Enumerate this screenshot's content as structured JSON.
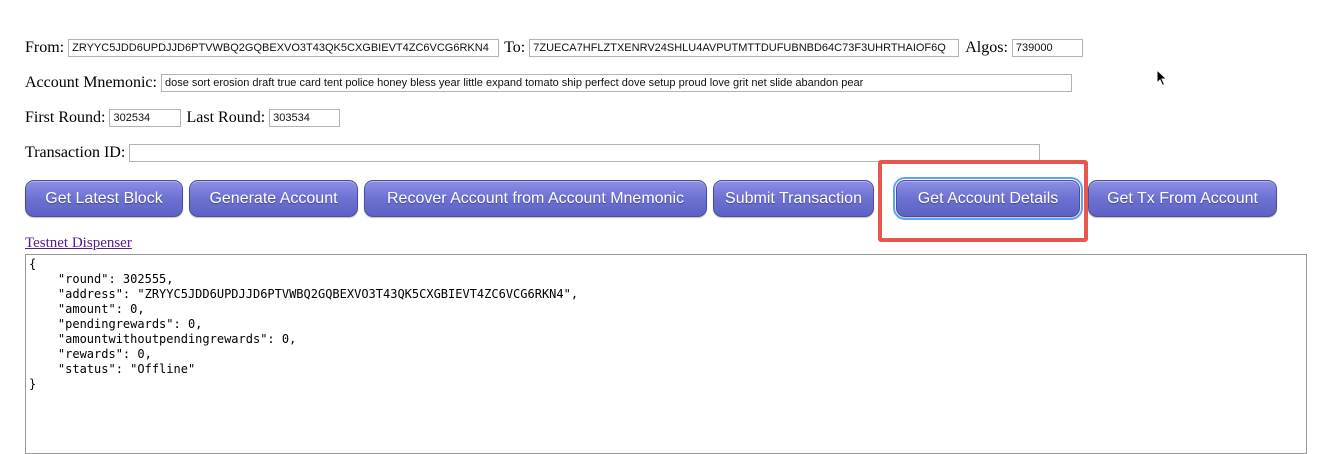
{
  "form": {
    "from_label": "From:",
    "from_value": "ZRYYC5JDD6UPDJJD6PTVWBQ2GQBEXVO3T43QK5CXGBIEVT4ZC6VCG6RKN4",
    "to_label": "To:",
    "to_value": "7ZUECA7HFLZTXENRV24SHLU4AVPUTMTTDUFUBNBD64C73F3UHRTHAIOF6Q",
    "algos_label": "Algos:",
    "algos_value": "739000",
    "mnemonic_label": "Account Mnemonic:",
    "mnemonic_value": "dose sort erosion draft true card tent police honey bless year little expand tomato ship perfect dove setup proud love grit net slide abandon pear",
    "first_round_label": "First Round:",
    "first_round_value": "302534",
    "last_round_label": "Last Round:",
    "last_round_value": "303534",
    "txid_label": "Transaction ID:",
    "txid_value": ""
  },
  "buttons": {
    "get_latest_block": "Get Latest Block",
    "generate_account": "Generate Account",
    "recover_account": "Recover Account from Account Mnemonic",
    "submit_transaction": "Submit Transaction",
    "get_account_details": "Get Account Details",
    "get_tx_from_account": "Get Tx From Account"
  },
  "link": {
    "testnet_dispenser": "Testnet Dispenser"
  },
  "output": {
    "text": "{\n    \"round\": 302555,\n    \"address\": \"ZRYYC5JDD6UPDJJD6PTVWBQ2GQBEXVO3T43QK5CXGBIEVT4ZC6VCG6RKN4\",\n    \"amount\": 0,\n    \"pendingrewards\": 0,\n    \"amountwithoutpendingrewards\": 0,\n    \"rewards\": 0,\n    \"status\": \"Offline\"\n}"
  },
  "colors": {
    "button_gradient_top": "#8b8fe4",
    "button_gradient_bottom": "#5d61c3",
    "highlight_box": "#e8574c",
    "focus_ring": "#5ea4f5",
    "visited_link": "#551a8b"
  },
  "icons": {
    "cursor": "mouse-pointer-icon"
  }
}
